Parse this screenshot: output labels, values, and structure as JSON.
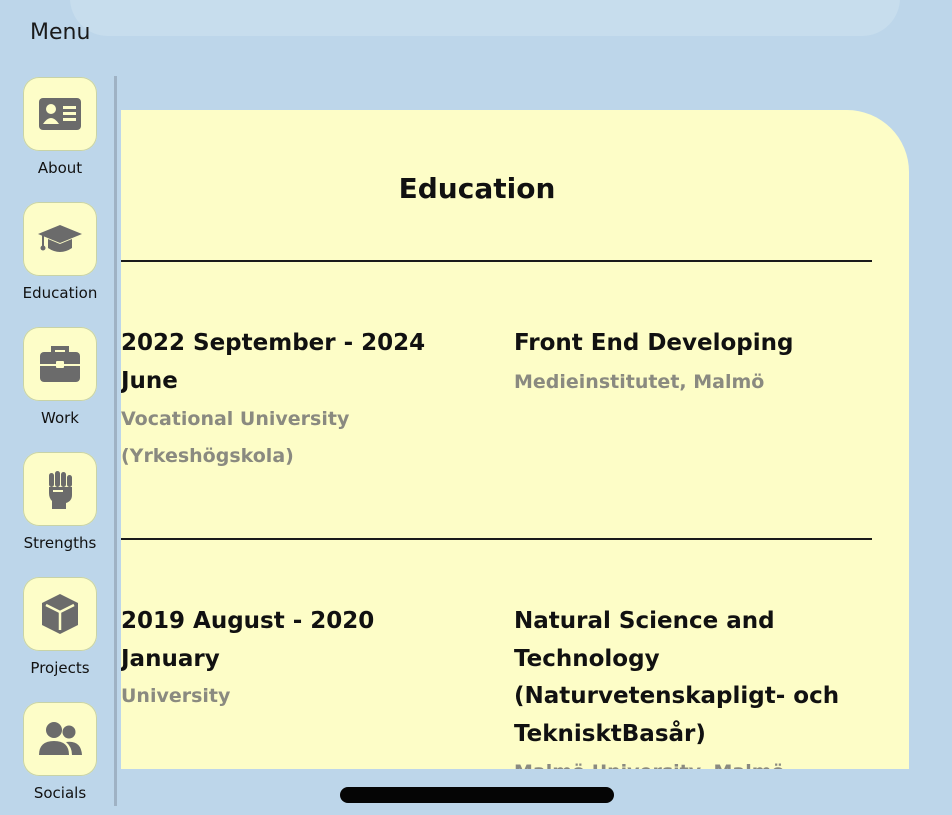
{
  "menu": {
    "label": "Menu",
    "items": [
      {
        "label": "About",
        "icon": "id-card-icon"
      },
      {
        "label": "Education",
        "icon": "graduation-cap-icon"
      },
      {
        "label": "Work",
        "icon": "briefcase-icon"
      },
      {
        "label": "Strengths",
        "icon": "raised-fist-icon"
      },
      {
        "label": "Projects",
        "icon": "cube-icon"
      },
      {
        "label": "Socials",
        "icon": "users-icon"
      }
    ]
  },
  "section": {
    "title": "Education",
    "entries": [
      {
        "date_line1": "2022 September - 2024",
        "date_line2": "June",
        "type_line1": "Vocational University",
        "type_line2": "(Yrkeshögskola)",
        "program": "Front End Developing",
        "school": "Medieinstitutet, Malmö"
      },
      {
        "date_line1": "2019 August - 2020",
        "date_line2": "January",
        "type_line1": "University",
        "program_line1": "Natural Science and",
        "program_line2": "Technology",
        "program_line3": "(Naturvetenskapligt- och",
        "program_line4": "TeknisktBasår)",
        "school": "Malmö University, Malmö"
      }
    ]
  },
  "colors": {
    "background": "#bdd6ea",
    "card": "#fdfdc7",
    "muted_text": "#8a8a80",
    "icon": "#6b6b6b"
  }
}
